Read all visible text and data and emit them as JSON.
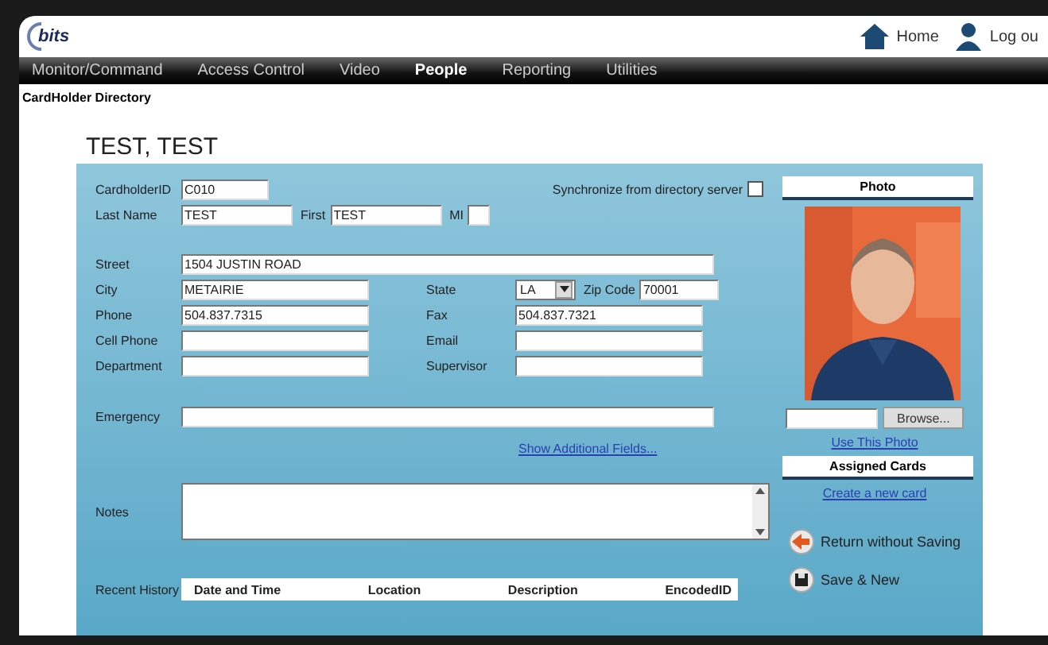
{
  "header": {
    "logo": "bits",
    "home": "Home",
    "logout": "Log ou"
  },
  "nav": [
    {
      "label": "Monitor/Command",
      "selected": false
    },
    {
      "label": "Access Control",
      "selected": false
    },
    {
      "label": "Video",
      "selected": false
    },
    {
      "label": "People",
      "selected": true
    },
    {
      "label": "Reporting",
      "selected": false
    },
    {
      "label": "Utilities",
      "selected": false
    }
  ],
  "breadcrumb": "CardHolder Directory",
  "title": "TEST, TEST",
  "form": {
    "cardholder_id": {
      "label": "CardholderID",
      "value": "C010"
    },
    "sync": {
      "label": "Synchronize from directory server",
      "checked": false
    },
    "last_name": {
      "label": "Last Name",
      "value": "TEST"
    },
    "first_name": {
      "label": "First",
      "value": "TEST"
    },
    "mi": {
      "label": "MI"
    },
    "street": {
      "label": "Street",
      "value": "1504 JUSTIN ROAD"
    },
    "rows": [
      {
        "left": {
          "label": "City",
          "value": "METAIRIE"
        },
        "right": {
          "kind": "state",
          "label": "State",
          "value": "LA",
          "zip_label": "Zip Code",
          "zip_value": "70001"
        }
      },
      {
        "left": {
          "label": "Phone",
          "value": "504.837.7315"
        },
        "right": {
          "kind": "text",
          "label": "Fax",
          "value": "504.837.7321"
        }
      },
      {
        "left": {
          "label": "Cell Phone"
        },
        "right": {
          "kind": "text",
          "label": "Email"
        }
      },
      {
        "left": {
          "label": "Department"
        },
        "right": {
          "kind": "text",
          "label": "Supervisor"
        }
      }
    ],
    "emergency": {
      "label": "Emergency"
    },
    "more_link": "Show Additional Fields...",
    "notes": {
      "label": "Notes"
    },
    "history": {
      "label": "Recent History",
      "columns": [
        "Date and Time",
        "Location",
        "Description",
        "EncodedID"
      ]
    }
  },
  "side": {
    "photo_title": "Photo",
    "browse": "Browse...",
    "use_photo": "Use This Photo",
    "cards_title": "Assigned Cards",
    "new_card": "Create a new card",
    "actions": [
      {
        "kind": "return",
        "label": "Return without Saving"
      },
      {
        "kind": "save",
        "label": "Save & New"
      }
    ]
  }
}
